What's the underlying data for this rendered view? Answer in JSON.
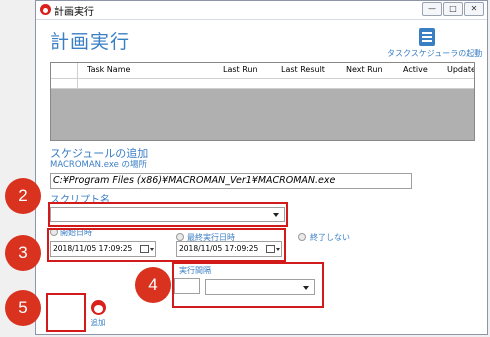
{
  "window": {
    "title": "計画実行"
  },
  "heading": "計画実行",
  "launch_button": {
    "label": "タスクスケジューラの起動"
  },
  "task_table": {
    "columns": [
      "Task Name",
      "Last Run",
      "Last Result",
      "Next Run",
      "Active",
      "Update"
    ]
  },
  "schedule_section": {
    "title": "スケジュールの追加",
    "location_label": "MACROMAN.exe の場所",
    "path_value": "C:¥Program Files (x86)¥MACROMAN_Ver1¥MACROMAN.exe"
  },
  "script": {
    "label": "スクリプト名",
    "value": ""
  },
  "start": {
    "label": "開始日時",
    "value": "2018/11/05 17:09:25"
  },
  "end": {
    "label": "最終実行日時",
    "value": "2018/11/05 17:09:25"
  },
  "no_end": {
    "label": "終了しない"
  },
  "interval": {
    "label": "実行間隔",
    "value": ""
  },
  "add_button": {
    "label": "追加"
  },
  "callouts": [
    "2",
    "3",
    "4",
    "5"
  ],
  "colors": {
    "accent": "#3a7ec4",
    "highlight": "#d21a1a",
    "callout": "#d9321f",
    "grid_bg": "#b0b0b0"
  },
  "icons": [
    "app-icon",
    "minimize-icon",
    "maximize-icon",
    "close-icon",
    "task-scheduler-icon",
    "calendar-icon",
    "chevron-down-icon",
    "add-icon"
  ]
}
